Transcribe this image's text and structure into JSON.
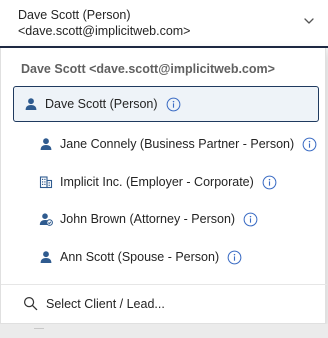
{
  "field": {
    "line1": "Dave Scott (Person)",
    "line2": "<dave.scott@implicitweb.com>"
  },
  "dropdown": {
    "group_header": "Dave Scott <dave.scott@implicitweb.com>",
    "options": [
      {
        "label": "Dave Scott (Person)",
        "icon": "person-icon",
        "selected": true
      },
      {
        "label": "Jane Connely (Business Partner - Person)",
        "icon": "person-icon",
        "selected": false
      },
      {
        "label": "Implicit Inc. (Employer - Corporate)",
        "icon": "building-icon",
        "selected": false
      },
      {
        "label": "John Brown (Attorney - Person)",
        "icon": "person-badge-icon",
        "selected": false
      },
      {
        "label": "Ann Scott (Spouse - Person)",
        "icon": "person-icon",
        "selected": false
      }
    ],
    "search_label": "Select Client / Lead..."
  },
  "colors": {
    "accent_dark": "#1f3a5f",
    "icon_blue": "#2f5b8f",
    "info_blue": "#3b6cc4",
    "selected_bg": "#eef3f8"
  }
}
